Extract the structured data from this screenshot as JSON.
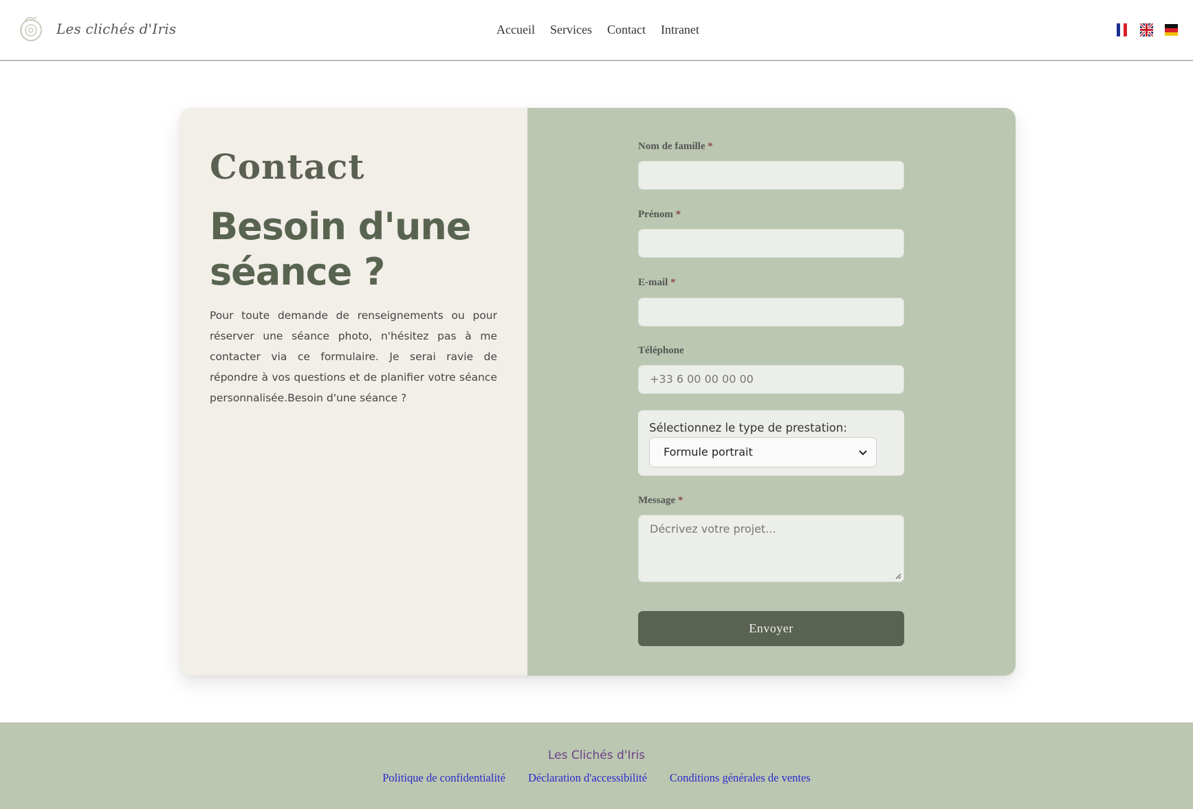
{
  "brand": {
    "logo_text": "Les clichés d'Iris"
  },
  "nav": {
    "items": [
      "Accueil",
      "Services",
      "Contact",
      "Intranet"
    ]
  },
  "languages": [
    "fr-flag-icon",
    "uk-flag-icon",
    "de-flag-icon"
  ],
  "contact": {
    "title": "Contact",
    "headline": "Besoin d'une séance ?",
    "intro": "Pour toute demande de renseignements ou pour réserver une séance photo, n'hésitez pas à me contacter via ce formulaire. Je serai ravie de répondre à vos questions et de planifier votre séance personnalisée.Besoin d'une séance ?"
  },
  "form": {
    "lastname": {
      "label": "Nom de famille",
      "required": "*",
      "value": ""
    },
    "firstname": {
      "label": "Prénom",
      "required": "*",
      "value": ""
    },
    "email": {
      "label": "E-mail",
      "required": "*",
      "value": ""
    },
    "phone": {
      "label": "Téléphone",
      "placeholder": "+33 6 00 00 00 00"
    },
    "service": {
      "label": "Sélectionnez le type de prestation:",
      "selected": "Formule portrait"
    },
    "message": {
      "label": "Message",
      "required": "*",
      "placeholder": "Décrivez votre projet..."
    },
    "submit_label": "Envoyer"
  },
  "footer": {
    "brand": "Les Clichés d'Iris",
    "links": [
      "Politique de confidentialité",
      "Déclaration d'accessibilité",
      "Conditions générales de ventes"
    ]
  },
  "colors": {
    "left_panel": "#f2eee8",
    "right_panel": "#bbc7b0",
    "button": "#5a6351",
    "footer_brand": "#6a3f8a",
    "footer_link": "#2a2acc"
  }
}
